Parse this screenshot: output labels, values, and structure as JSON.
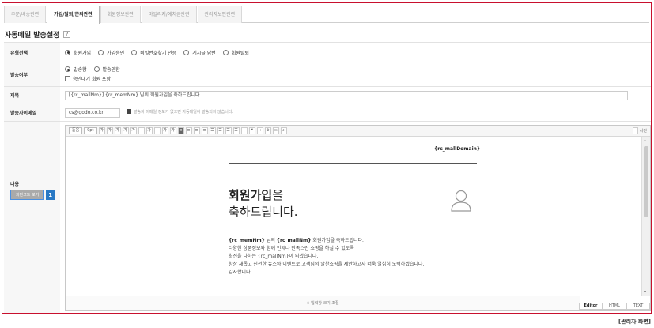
{
  "tabs": [
    {
      "label": "주문/배송관련",
      "active": false
    },
    {
      "label": "가입/탈퇴/문의관련",
      "active": true
    },
    {
      "label": "회원정보관련",
      "active": false
    },
    {
      "label": "마일리지/예치금관련",
      "active": false
    },
    {
      "label": "관리자보안관련",
      "active": false
    }
  ],
  "section": {
    "title": "자동메일 발송설정",
    "help": "?"
  },
  "type_row": {
    "label": "유형선택",
    "options": [
      {
        "label": "회원가입",
        "checked": true
      },
      {
        "label": "가입승인",
        "checked": false
      },
      {
        "label": "비밀번호찾기 인증",
        "checked": false
      },
      {
        "label": "게시글 답변",
        "checked": false
      },
      {
        "label": "회원탈퇴",
        "checked": false
      }
    ]
  },
  "send_row": {
    "label": "발송여부",
    "options": [
      {
        "label": "발송함",
        "checked": true
      },
      {
        "label": "발송안함",
        "checked": false
      }
    ],
    "checkbox_label": "승인대기 회원 포함"
  },
  "subject_row": {
    "label": "제목",
    "value": "[{rc_mallNm}] {rc_memNm} 님의 회원가입을 축하드립니다."
  },
  "sender_row": {
    "label": "발송자이메일",
    "value": "cs@godo.co.kr",
    "hint": "발송자 이메일 정보가 없으면 자동메일이 발송되지 않습니다."
  },
  "content_row": {
    "label": "내용",
    "source_button": "치환코드 보기",
    "badge": "1"
  },
  "toolbar": {
    "font": "돋움",
    "size": "9pt",
    "buttons": [
      "가",
      "가",
      "가",
      "가",
      "가",
      "·",
      "가",
      "·",
      "가",
      "가",
      "≡",
      "≡",
      "≡",
      "≡",
      "☰",
      "☰",
      "☰",
      "☰",
      "I",
      "❝",
      "⇔",
      "⊕",
      "▭",
      "⌕"
    ],
    "right_label": "사진"
  },
  "preview": {
    "mall_domain": "{rc_mallDomain}",
    "headline_bold": "회원가입",
    "headline_suffix": "을",
    "headline_line2": "축하드립니다.",
    "line1_var1": "{rc_memNm}",
    "line1_mid": " 님의 ",
    "line1_var2": "{rc_mallNm}",
    "line1_end": " 회원가입을 축하드립니다.",
    "line2": "다양한 상품정보와 함께 언제나 만족스런 쇼핑을 하실 수 있도록",
    "line3": "최선을 다하는 {rc_mallNm}이 되겠습니다.",
    "line4": "항상 새롭고 신선한 뉴스와 이벤트로 고객님의 알찬쇼핑을 제안하고자 더욱 열심히 노력하겠습니다.",
    "line5": "감사합니다."
  },
  "resize_label": "↕ 입력창 크기 조절",
  "modes": [
    {
      "label": "Editor",
      "active": true
    },
    {
      "label": "HTML",
      "active": false
    },
    {
      "label": "TEXT",
      "active": false
    }
  ],
  "caption": "[관리자 화면]",
  "colors": {
    "frame": "#c8102e",
    "badge": "#2979c5"
  }
}
